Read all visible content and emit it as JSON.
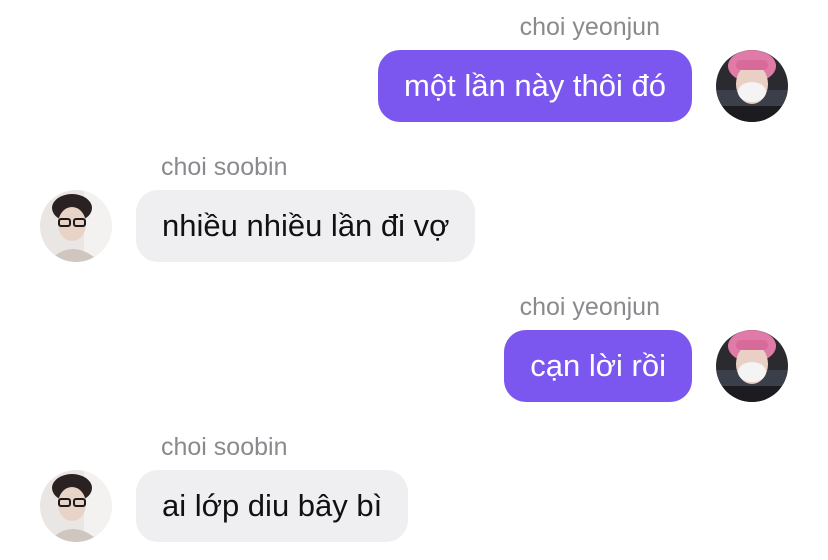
{
  "colors": {
    "outgoing_bubble": "#7b57f0",
    "incoming_bubble": "#efeff1",
    "sender_name": "#8a8a8e"
  },
  "messages": [
    {
      "direction": "outgoing",
      "sender": "choi yeonjun",
      "text": "một lần này thôi đó",
      "avatar_icon": "avatar-yeonjun-pink-hair-mask"
    },
    {
      "direction": "incoming",
      "sender": "choi soobin",
      "text": "nhiều nhiều lần đi vợ",
      "avatar_icon": "avatar-soobin-glasses"
    },
    {
      "direction": "outgoing",
      "sender": "choi yeonjun",
      "text": "cạn lời rồi",
      "avatar_icon": "avatar-yeonjun-pink-hair-mask"
    },
    {
      "direction": "incoming",
      "sender": "choi soobin",
      "text": "ai lớp diu bây bì",
      "avatar_icon": "avatar-soobin-glasses"
    }
  ]
}
